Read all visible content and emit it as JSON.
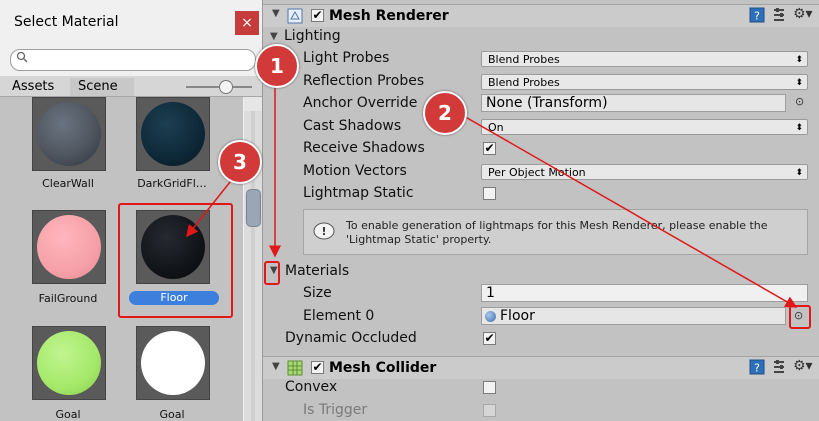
{
  "select_window": {
    "title": "Select Material",
    "close_glyph": "×",
    "search_placeholder": "",
    "tabs": [
      {
        "label": "Assets"
      },
      {
        "label": "Scene"
      }
    ],
    "materials": [
      {
        "name": "ClearWall",
        "color": "#4f5660"
      },
      {
        "name": "DarkGridFl…",
        "color": "#0f2a3a"
      },
      {
        "name": "FailGround",
        "color": "#f6a0a8"
      },
      {
        "name": "Floor",
        "color": "#111418",
        "selected": true
      },
      {
        "name": "Goal",
        "color": "#a5e86a"
      },
      {
        "name": "Goal",
        "color": "#ffffff"
      }
    ]
  },
  "inspector": {
    "mesh_renderer": {
      "title": "Mesh Renderer",
      "enabled": true,
      "lighting_label": "Lighting",
      "light_probes_label": "Light Probes",
      "light_probes_value": "Blend Probes",
      "reflection_probes_label": "Reflection Probes",
      "reflection_probes_value": "Blend Probes",
      "anchor_override_label": "Anchor Override",
      "anchor_override_value": "None (Transform)",
      "cast_shadows_label": "Cast Shadows",
      "cast_shadows_value": "On",
      "receive_shadows_label": "Receive Shadows",
      "receive_shadows": true,
      "motion_vectors_label": "Motion Vectors",
      "motion_vectors_value": "Per Object Motion",
      "lightmap_static_label": "Lightmap Static",
      "lightmap_static": false,
      "info_text_line1": "To enable generation of lightmaps for this Mesh Renderer, please enable the",
      "info_text_line2": "'Lightmap Static' property.",
      "materials_label": "Materials",
      "size_label": "Size",
      "size_value": "1",
      "element0_label": "Element 0",
      "element0_value": "Floor",
      "dynamic_occluded_label": "Dynamic Occluded",
      "dynamic_occluded": true
    },
    "mesh_collider": {
      "title": "Mesh Collider",
      "enabled": true,
      "convex_label": "Convex",
      "convex": false,
      "is_trigger_label": "Is Trigger",
      "is_trigger": false
    }
  },
  "annotations": {
    "callout_1": "1",
    "callout_2": "2",
    "callout_3": "3",
    "highlight_color": "#e01818"
  },
  "colors": {
    "selected_label_bg": "#3d7fdc",
    "callout_bg": "#d23a3a"
  }
}
